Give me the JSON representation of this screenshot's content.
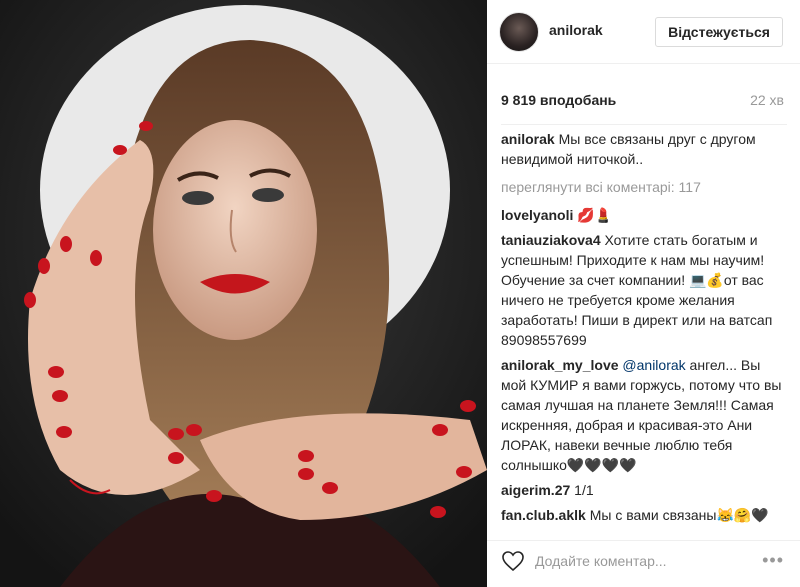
{
  "post": {
    "username": "anilorak",
    "follow_label": "Відстежується",
    "likes_label": "9 819 вподобань",
    "time_label": "22 хв"
  },
  "caption": {
    "user": "anilorak",
    "text": "Мы все связаны друг с другом невидимой ниточкой.."
  },
  "view_all_comments": "переглянути всі коментарі: 117",
  "comments": [
    {
      "user": "lovelyanoli",
      "text": "💋💄"
    },
    {
      "user": "taniauziakova4",
      "text": "Хотите стать богатым и успешным! Приходите к нам мы научим! Обучение за счет компании! 💻💰от вас ничего не требуется кроме желания заработать! Пиши в директ или на ватсап 89098557699"
    },
    {
      "user": "anilorak_my_love",
      "mention": "@anilorak",
      "text": "ангел... Вы мой КУМИР я вами горжусь, потому что вы самая лучшая на планете Земля!!! Самая искренняя, добрая и красивая-это Ани ЛОРАК, навеки вечные люблю тебя солнышко🖤🖤🖤🖤"
    },
    {
      "user": "aigerim.27",
      "text": "1/1"
    },
    {
      "user": "fan.club.aklk",
      "text": "Мы с вами связаны😹🤗🖤"
    }
  ],
  "add_comment": {
    "placeholder": "Додайте коментар..."
  },
  "icons": {
    "heart": "heart-outline-icon",
    "more": "more-options-icon"
  },
  "colors": {
    "lips": "#c4161c",
    "nails": "#c8141e",
    "halo": "#e8e8e8"
  }
}
